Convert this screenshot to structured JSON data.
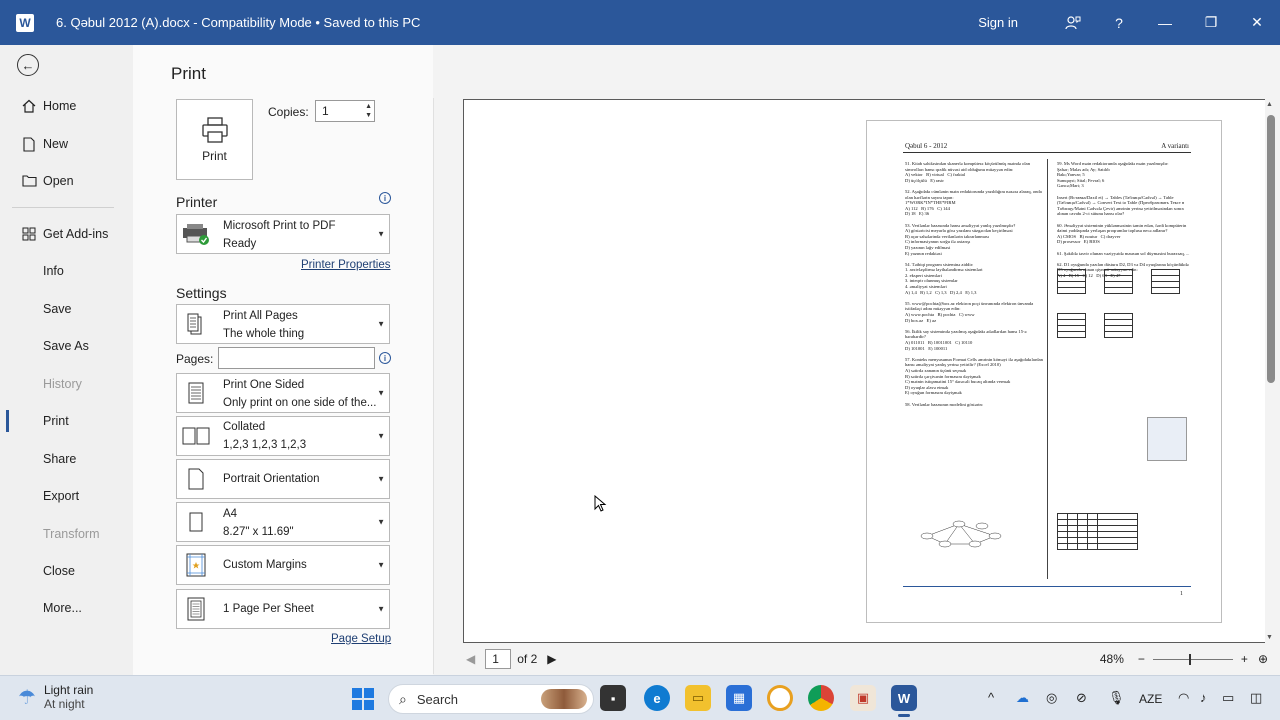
{
  "titlebar": {
    "title": "6. Qəbul 2012 (A).docx  -  Compatibility Mode • Saved to this PC",
    "signin": "Sign in",
    "help": "?",
    "minimize": "—",
    "restore": "❐",
    "close": "✕"
  },
  "nav": {
    "items": [
      {
        "label": "Home"
      },
      {
        "label": "New"
      },
      {
        "label": "Open"
      },
      {
        "label": "Get Add-ins"
      },
      {
        "label": "Info"
      },
      {
        "label": "Save"
      },
      {
        "label": "Save As"
      },
      {
        "label": "History"
      },
      {
        "label": "Print"
      },
      {
        "label": "Share"
      },
      {
        "label": "Export"
      },
      {
        "label": "Transform"
      },
      {
        "label": "Close"
      },
      {
        "label": "More..."
      }
    ]
  },
  "print": {
    "title": "Print",
    "button_label": "Print",
    "copies_label": "Copies:",
    "copies_value": "1",
    "printer_heading": "Printer",
    "printer_name": "Microsoft Print to PDF",
    "printer_status": "Ready",
    "printer_properties": "Printer Properties",
    "settings_heading": "Settings",
    "pages_label": "Pages:",
    "settings": [
      {
        "line1": "Print All Pages",
        "line2": "The whole thing"
      },
      {
        "line1": "Print One Sided",
        "line2": "Only print on one side of the..."
      },
      {
        "line1": "Collated",
        "line2": "1,2,3    1,2,3    1,2,3"
      },
      {
        "line1": "Portrait Orientation",
        "line2": ""
      },
      {
        "line1": "A4",
        "line2": "8.27\" x 11.69\""
      },
      {
        "line1": "Custom Margins",
        "line2": ""
      },
      {
        "line1": "1 Page Per Sheet",
        "line2": ""
      }
    ],
    "page_setup": "Page Setup"
  },
  "preview": {
    "page_header_left": "Qəbul 6 - 2012",
    "page_header_right": "A variantı",
    "page_number": "1",
    "current_page": "1",
    "of_pages": "of 2",
    "zoom": "48%"
  },
  "preview_text": {
    "left_col": "51. Kitab səhifəsindən skanerlə kompüterə köçürülmüş mətndə olan simvolları hansı qrafik nüvəsi aid olduğunu müəyyən edin:\nA) vektor   B) virtual   C) fraktal\nD) üçölçülü   E) rastr\n\n52. Aşağıdakı cümlənin mətn redaktorunda yazıldığını nəzərə alaraq, onda olan hərflərin sayını tapın:\n1*WORK*IN*THE*FIRM\nA) 112   B) 176   C) 144\nD) 18   E) 36\n\n53. Verilənlər bazasında hansı əməliyyat yanlış yazılmışdır?\nA) göstəricisi meyarla görə yazılanı süzgəcdən keçirilməsi\nB) açar sahələrində verilənlərin təkrarlanması\nC) informasiyanın sorğu ilə axtarışı\nD) yazının ləğv edilməsi\nE) yazının redaktəsi\n\n54. Tətbiqi program sisteminə aiddir:\n1. arxivləşdirmə layihələndirmə sistemləri\n2. ekspert sistemləri\n3. inteqrir olunmuş sistemlər\n4. əməliyyat sistemləri\nA) 1,4   B) 1,2   C) 1,3   D) 2,4   E) 1,3\n\n55. www@pochta@box.az elektron poçt ünvanında elektron ünvanda istifadəçi adını müəyyən edin:\nA) www.pochta   B) pochta   C) www\nD) box.az   E) az\n\n56. İkilik say sistemində yazılmış aşağıdakı ədədlərdən hansı 15-ə bərabərdir?\nA) 011011   B) 10011001   C) 10110\nD) 101001   E) 100011\n\n57. Konteks menyusunun Format Cells əmrinin köməyi ilə aşağıdakılardan hansı əməliyyat yanlış yerinə yetirilir? (Excel 2010)\nA) sətirdə xananın üçünü seçmək\nB) sətirdə çərçivənin formasını dəyişmək\nC) mətnin istiqamətini 15° dərəcəli bucaq altında vermək\nD) oyuqlar əlavə etmək\nE) oyuğun formasını dəyişmək\n\n58. Verilənlər bazasının modelini göstərin:",
    "right_col": "59. Ms Word mətn redaktorunda aşağıdakı mətn yazılmışdır:\nŞahər; Maləs adı; Ay; Satılıb\nBakı;Yanvar; 5\nSumqayıt; Sital; Fevral; 6\nGəncə;Mart; 3\n\nInsert (Вставка/Daxil et) → Tables (Таблица/Cədvəl) → Table (Таблица/Cədvəl) → Convert Text to Table (Преобразовать Текст в Таблицу/Mətni Cədvələ Çevir) əmrinin yerinə yetirilməsindən sonra alınan cavabı 2-ci sütunu hansı olar?\n\n60. Əməliyyat sisteminin yüklənməsinin təmin edən, fərdi kompüterin daimi yaddaşında yerləşən proqramlar toplusu necə adlanır?\nA) CMOS   B) noutur   C) drayver\nD) prosessor   E) BIOS\n\n61. Şəkildə təsvir olunan vəziyyətdə mausun sol düyməsini buraxsaq, ...\n\n62. D1 oyuğunda yazılan düsturu D2, D3 və D4 oyuqlarına köçürdükdə D5 oyuğunda alınan qiyməti müəyyən edin:\nA) 4   B) 15   C) 12   D) 63   E) 47"
  },
  "taskbar": {
    "weather_line1": "Light rain",
    "weather_line2": "At night",
    "search_label": "Search",
    "language": "AZE"
  },
  "colors": {
    "accent": "#2b579a",
    "titlebar": "#2b579a"
  }
}
